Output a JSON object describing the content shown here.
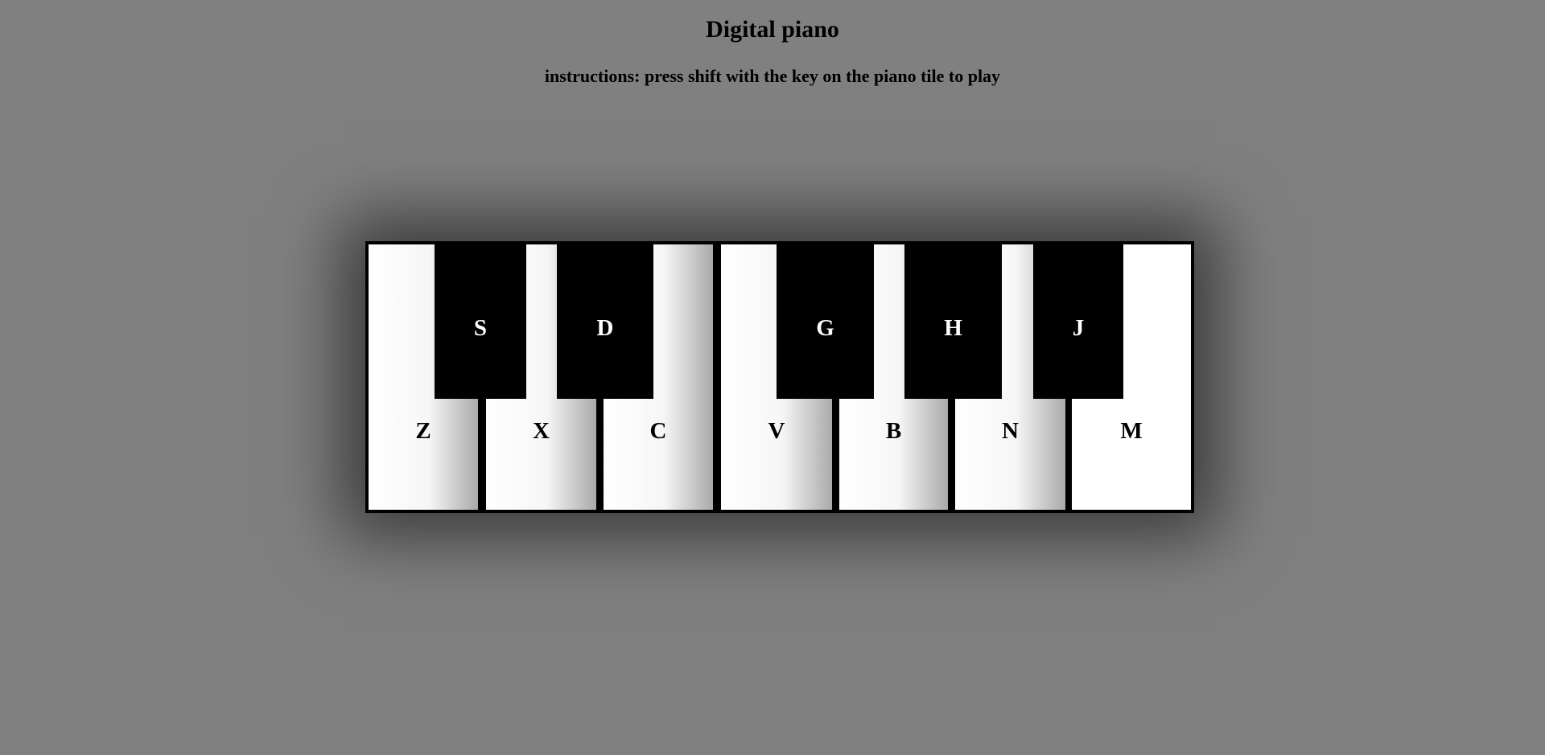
{
  "title": "Digital piano",
  "instructions": "instructions: press shift with the key on the piano tile to play",
  "white_keys": [
    "Z",
    "X",
    "C",
    "V",
    "B",
    "N",
    "M"
  ],
  "black_keys": [
    "S",
    "D",
    "G",
    "H",
    "J"
  ]
}
